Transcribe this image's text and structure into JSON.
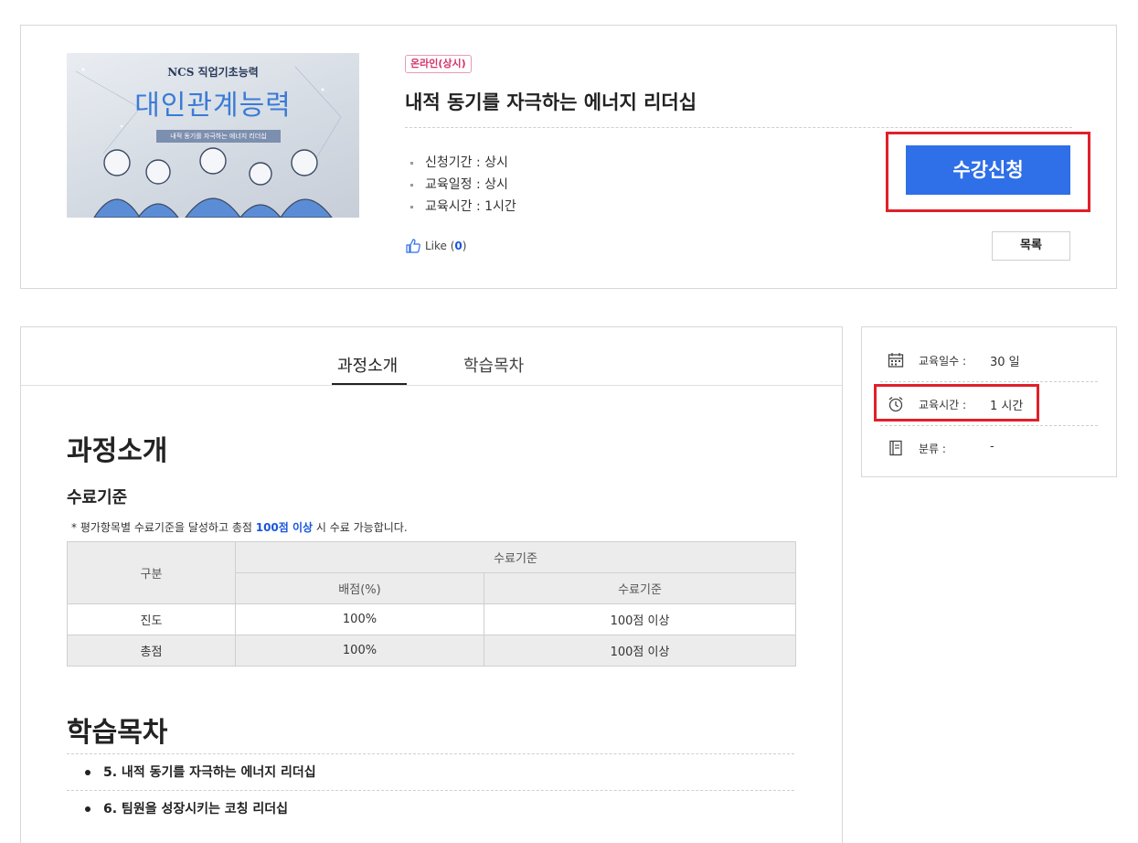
{
  "course": {
    "thumbnail": {
      "subtitle": "NCS 직업기초능력",
      "main": "대인관계능력",
      "strip": "내적 동기를 자극하는 에너지 리더십"
    },
    "badge": "온라인(상시)",
    "title": "내적 동기를 자극하는 에너지 리더십",
    "info": [
      "신청기간 : 상시",
      "교육일정 : 상시",
      "교육시간 : 1시간"
    ],
    "like_label": "Like (",
    "like_count": "0",
    "like_close": ")",
    "enroll_label": "수강신청",
    "list_label": "목록"
  },
  "tabs": [
    "과정소개",
    "학습목차"
  ],
  "intro": {
    "heading": "과정소개",
    "sub_heading": "수료기준",
    "note_prefix": "* 평가항목별 수료기준을 달성하고 총점 ",
    "note_highlight": "100점 이상",
    "note_suffix": " 시 수료 가능합니다.",
    "table": {
      "col_group": "구분",
      "col_criteria": "수료기준",
      "col_weight": "배점(%)",
      "col_pass": "수료기준",
      "rows": [
        {
          "name": "진도",
          "weight": "100%",
          "pass": "100점 이상"
        },
        {
          "name": "총점",
          "weight": "100%",
          "pass": "100점 이상"
        }
      ]
    }
  },
  "toc": {
    "heading": "학습목차",
    "items": [
      "5. 내적 동기를 자극하는 에너지 리더십",
      "6. 팀원을 성장시키는 코칭 리더십"
    ]
  },
  "side": {
    "days_label": "교육일수 :",
    "days_value": "30 일",
    "time_label": "교육시간 :",
    "time_value": "1 시간",
    "category_label": "분류 :",
    "category_value": "-"
  },
  "colors": {
    "accent": "#2f6fe8",
    "highlight_frame": "#e0202a",
    "badge": "#d6336c"
  }
}
